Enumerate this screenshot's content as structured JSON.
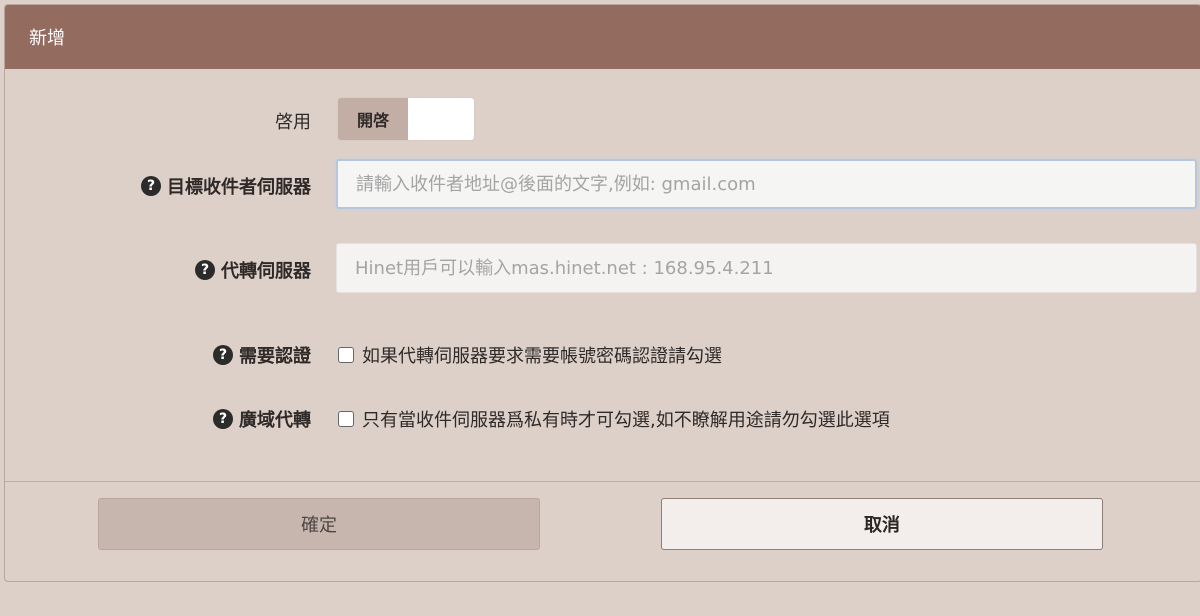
{
  "dialog": {
    "title": "新增"
  },
  "form": {
    "enable": {
      "label": "啓用",
      "toggle_label": "開啓",
      "value": true
    },
    "target_server": {
      "label": "目標收件者伺服器",
      "value": "",
      "placeholder": "請輸入收件者地址@後面的文字,例如: gmail.com",
      "icon": "question-circle-icon"
    },
    "relay_server": {
      "label": "代轉伺服器",
      "value": "",
      "placeholder": "Hinet用戶可以輸入mas.hinet.net : 168.95.4.211",
      "icon": "question-circle-icon"
    },
    "require_auth": {
      "label": "需要認證",
      "checkbox_label": "如果代轉伺服器要求需要帳號密碼認證請勾選",
      "checked": false,
      "icon": "question-circle-icon"
    },
    "wan_relay": {
      "label": "廣域代轉",
      "checkbox_label": "只有當收件伺服器爲私有時才可勾選,如不瞭解用途請勿勾選此選項",
      "checked": false,
      "icon": "question-circle-icon"
    }
  },
  "buttons": {
    "confirm_label": "確定",
    "cancel_label": "取消"
  },
  "colors": {
    "header_bg": "#936b5f",
    "dialog_bg": "#dcd0c9",
    "confirm_bg": "#c7b6ad"
  }
}
